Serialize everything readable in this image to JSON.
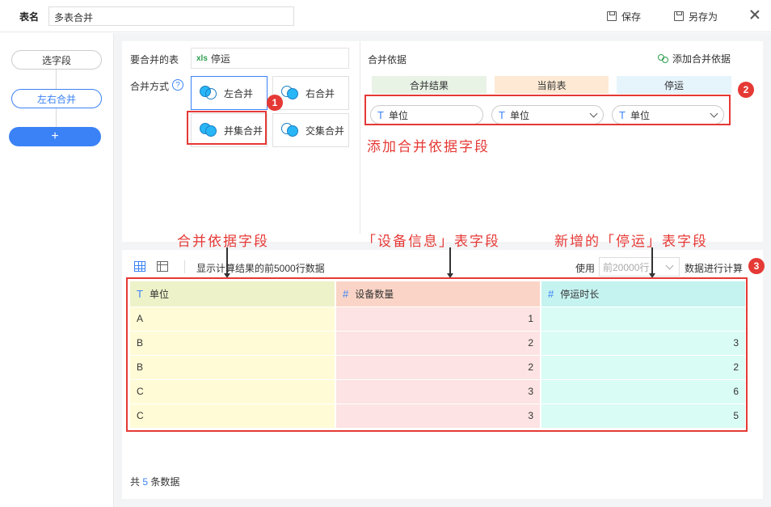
{
  "topbar": {
    "name_label": "表名",
    "name_value": "多表合并",
    "save_label": "保存",
    "save_as_label": "另存为"
  },
  "rail": {
    "select_fields": "选字段",
    "lr_merge": "左右合并",
    "add": "+"
  },
  "upper": {
    "merge_table_label": "要合并的表",
    "merge_table_value": "停运",
    "xls_icon_text": "xls",
    "merge_mode_label": "合并方式",
    "help_char": "?",
    "modes": [
      "左合并",
      "右合并",
      "并集合并",
      "交集合并"
    ],
    "basis_title": "合并依据",
    "add_basis_label": "添加合并依据",
    "basis_headers": [
      "合并结果",
      "当前表",
      "停运"
    ],
    "basis_header_colors": [
      "#e8f3e6",
      "#fde9d4",
      "#e6f4fb"
    ],
    "basis_values": [
      "单位",
      "单位",
      "单位"
    ],
    "field_type_glyph": "T"
  },
  "annotations": {
    "badge1": "1",
    "badge2": "2",
    "badge3": "3",
    "add_basis_note": "添加合并依据字段",
    "basis_field_note": "合并依据字段",
    "device_info_note": "「设备信息」表字段",
    "new_stop_note": "新增的「停运」表字段"
  },
  "toolbar": {
    "preview_text": "显示计算结果的前5000行数据",
    "use_label": "使用",
    "row_select_value": "前20000行",
    "calc_label": "数据进行计算"
  },
  "table": {
    "headers": [
      {
        "type": "T",
        "label": "单位"
      },
      {
        "type": "#",
        "label": "设备数量"
      },
      {
        "type": "#",
        "label": "停运时长"
      }
    ],
    "rows": [
      [
        "A",
        "1",
        ""
      ],
      [
        "B",
        "2",
        "3"
      ],
      [
        "B",
        "2",
        "2"
      ],
      [
        "C",
        "3",
        "6"
      ],
      [
        "C",
        "3",
        "5"
      ]
    ]
  },
  "footer": {
    "prefix": "共",
    "count": "5",
    "suffix": "条数据"
  }
}
